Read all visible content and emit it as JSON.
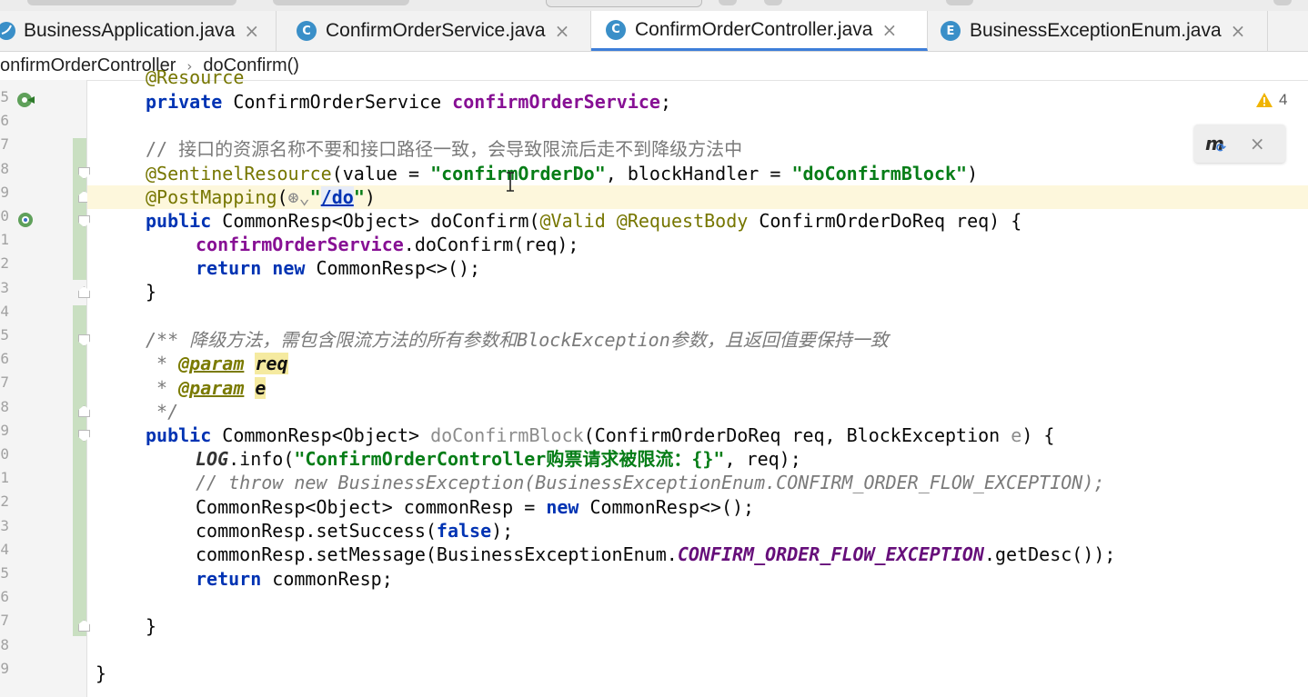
{
  "tabs": [
    {
      "label": "BusinessApplication.java",
      "icon": "spring-class-icon",
      "active": false
    },
    {
      "label": "ConfirmOrderService.java",
      "icon": "class-icon",
      "badge": "C",
      "active": false
    },
    {
      "label": "ConfirmOrderController.java",
      "icon": "class-icon",
      "badge": "C",
      "active": true
    },
    {
      "label": "BusinessExceptionEnum.java",
      "icon": "enum-icon",
      "badge": "E",
      "active": false
    }
  ],
  "tab_close_glyph": "×",
  "breadcrumb": {
    "class": "onfirmOrderController",
    "method": "doConfirm()",
    "separator": "›"
  },
  "inspection": {
    "warning_count": "4"
  },
  "popup_close_glyph": "×",
  "line_numbers": [
    "5",
    "6",
    "7",
    "8",
    "9",
    "0",
    "1",
    "2",
    "3",
    "4",
    "5",
    "6",
    "7",
    "8",
    "9",
    "0",
    "1",
    "2",
    "3",
    "4",
    "5",
    "6",
    "7",
    "8",
    "9"
  ],
  "code": {
    "l0_ann": "@Resource",
    "l1_kw": "private",
    "l1_type": " ConfirmOrderService ",
    "l1_field": "confirmOrderService",
    "l1_end": ";",
    "l3_comment": "// 接口的资源名称不要和接口路径一致，会导致限流后走不到降级方法中",
    "l4_ann": "@SentinelResource",
    "l4_a": "(value = ",
    "l4_s1": "\"confirmOrderDo\"",
    "l4_b": ", blockHandler = ",
    "l4_s2": "\"doConfirmBlock\"",
    "l4_c": ")",
    "l5_ann": "@PostMapping",
    "l5_a": "(",
    "l5_web": "⊛⌄",
    "l5_q1": "\"",
    "l5_url": "/do",
    "l5_q2": "\"",
    "l5_b": ")",
    "l6_kw": "public",
    "l6_a": " CommonResp<Object> doConfirm(",
    "l6_ann1": "@Valid",
    "l6_sp": " ",
    "l6_ann2": "@RequestBody",
    "l6_b": " ConfirmOrderDoReq req) {",
    "l7_field": "confirmOrderService",
    "l7_a": ".doConfirm(req);",
    "l8_kw1": "return",
    "l8_sp": " ",
    "l8_kw2": "new",
    "l8_a": " CommonResp<>();",
    "l9_a": "}",
    "l11_a": "/** 降级方法，需包含限流方法的所有参数和",
    "l11_b": "BlockException",
    "l11_c": "参数，且返回值要保持一致",
    "l12_star": " * ",
    "l12_tag": "@param",
    "l12_sp": " ",
    "l12_p": "req",
    "l13_star": " * ",
    "l13_tag": "@param",
    "l13_sp": " ",
    "l13_p": "e",
    "l14_a": " */",
    "l15_kw": "public",
    "l15_a": " CommonResp<Object> ",
    "l15_m": "doConfirmBlock",
    "l15_b": "(ConfirmOrderDoReq req, BlockException ",
    "l15_e": "e",
    "l15_c": ") {",
    "l16_log": "LOG",
    "l16_a": ".info(",
    "l16_s": "\"ConfirmOrderController购票请求被限流：{}\"",
    "l16_b": ", req);",
    "l17_comment": "// throw new BusinessException(BusinessExceptionEnum.CONFIRM_ORDER_FLOW_EXCEPTION);",
    "l18_a": "CommonResp<Object> commonResp = ",
    "l18_kw": "new",
    "l18_b": " CommonResp<>();",
    "l19_a": "commonResp.setSuccess(",
    "l19_kw": "false",
    "l19_b": ");",
    "l20_a": "commonResp.setMessage(BusinessExceptionEnum.",
    "l20_const": "CONFIRM_ORDER_FLOW_EXCEPTION",
    "l20_b": ".getDesc());",
    "l21_kw": "return",
    "l21_a": " commonResp;",
    "l23_a": "}",
    "l25_a": "}"
  }
}
